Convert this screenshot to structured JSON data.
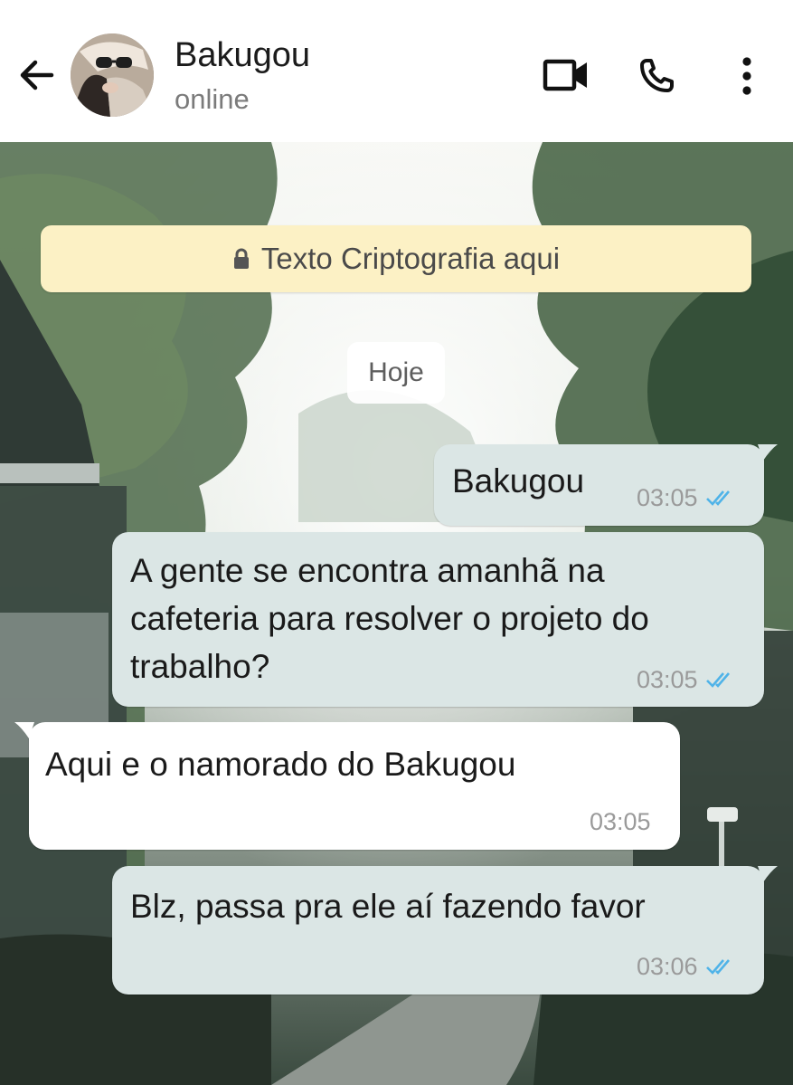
{
  "header": {
    "contact_name": "Bakugou",
    "status": "online",
    "icons": {
      "back": "arrow-left-icon",
      "video": "video-camera-icon",
      "call": "phone-icon",
      "menu": "more-vertical-icon"
    }
  },
  "chat": {
    "encryption_notice": "Texto Criptografia aqui",
    "date_label": "Hoje",
    "messages": [
      {
        "direction": "out",
        "text": "Bakugou",
        "time": "03:05",
        "status": "read"
      },
      {
        "direction": "out",
        "text": "A gente se encontra amanhã na cafeteria para resolver o projeto do trabalho?",
        "time": "03:05",
        "status": "read"
      },
      {
        "direction": "in",
        "text": "Aqui e o namorado do Bakugou",
        "time": "03:05"
      },
      {
        "direction": "out",
        "text": "Blz, passa pra ele aí fazendo favor",
        "time": "03:06",
        "status": "read"
      }
    ]
  },
  "colors": {
    "outgoing_bubble": "#dbe6e5",
    "incoming_bubble": "#ffffff",
    "encryption_bg": "#fcf1c5",
    "read_ticks": "#4fb3e8"
  }
}
